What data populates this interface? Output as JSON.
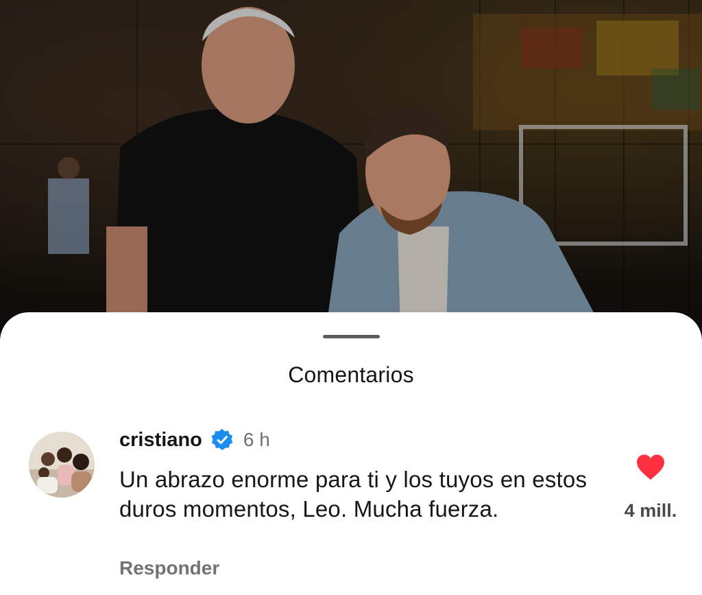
{
  "post_image": {
    "icon": "photo"
  },
  "sheet": {
    "title": "Comentarios"
  },
  "comment": {
    "avatar_icon": "avatar",
    "username": "cristiano",
    "verified_icon": "verified-badge",
    "time": "6 h",
    "text": "Un abrazo enorme para ti y los tuyos en estos duros momentos, Leo. Mucha fuerza.",
    "reply_label": "Responder",
    "like_icon": "heart",
    "like_count": "4 mill.",
    "liked": true
  },
  "colors": {
    "sheet_bg": "#ffffff",
    "verified": "#1d8bf0",
    "heart": "#ff3040",
    "text": "#161616",
    "muted": "#737373"
  }
}
